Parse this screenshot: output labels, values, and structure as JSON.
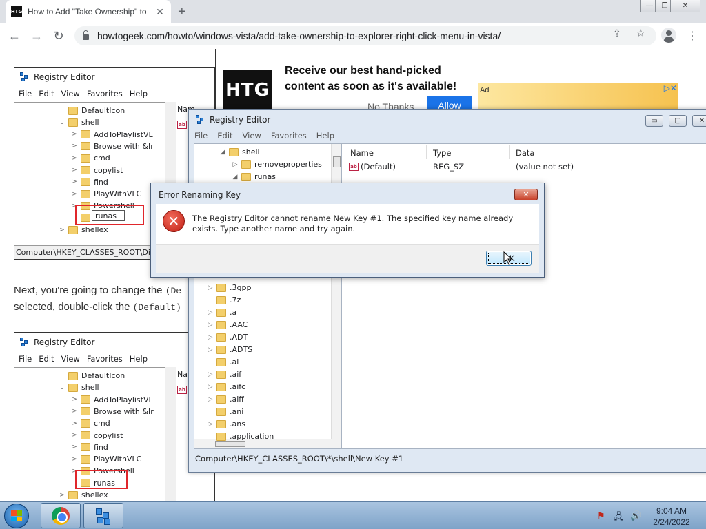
{
  "browser": {
    "tab": {
      "title": "How to Add \"Take Ownership\" to",
      "favicon": "HTG",
      "close": "✕"
    },
    "new_tab": "+",
    "window_controls": {
      "minimize": "—",
      "restore": "❐",
      "close": "✕"
    },
    "nav": {
      "back": "←",
      "forward": "→",
      "reload": "↻"
    },
    "url": "howtogeek.com/howto/windows-vista/add-take-ownership-to-explorer-right-click-menu-in-vista/",
    "omnibox_icons": {
      "share": "⇪",
      "bookmark": "☆"
    },
    "menu": "⋮"
  },
  "page": {
    "ad": {
      "logo": "HTG",
      "headline": "Receive our best hand-picked content as soon as it's available!",
      "no_thanks": "No Thanks",
      "allow": "Allow",
      "banner_tag": "Ad",
      "banner_close": "▷✕"
    },
    "paragraph": {
      "line1_prefix": "Next, you're going to change the ",
      "line1_code": "(De",
      "line2_prefix": "selected, double-click the ",
      "line2_code": "(Default)"
    },
    "screenshot1": {
      "title": "Registry Editor",
      "menu": [
        "File",
        "Edit",
        "View",
        "Favorites",
        "Help"
      ],
      "tree": [
        {
          "label": "DefaultIcon",
          "indent": 1,
          "exp": ""
        },
        {
          "label": "shell",
          "indent": 1,
          "exp": "⌄"
        },
        {
          "label": "AddToPlaylistVL",
          "indent": 2,
          "exp": ">"
        },
        {
          "label": "Browse with &Ir",
          "indent": 2,
          "exp": ">"
        },
        {
          "label": "cmd",
          "indent": 2,
          "exp": ">"
        },
        {
          "label": "copylist",
          "indent": 2,
          "exp": ">"
        },
        {
          "label": "find",
          "indent": 2,
          "exp": ">"
        },
        {
          "label": "PlayWithVLC",
          "indent": 2,
          "exp": ">"
        },
        {
          "label": "Powershell",
          "indent": 2,
          "exp": ">"
        },
        {
          "label": "",
          "indent": 2,
          "exp": ""
        },
        {
          "label": "shellex",
          "indent": 1,
          "exp": ">"
        }
      ],
      "edit_value": "runas",
      "list_header": "Nam",
      "list_value": "(D",
      "status": "Computer\\HKEY_CLASSES_ROOT\\Dire"
    },
    "screenshot2": {
      "title": "Registry Editor",
      "menu": [
        "File",
        "Edit",
        "View",
        "Favorites",
        "Help"
      ],
      "tree": [
        {
          "label": "DefaultIcon",
          "indent": 1,
          "exp": ""
        },
        {
          "label": "shell",
          "indent": 1,
          "exp": "⌄"
        },
        {
          "label": "AddToPlaylistVL",
          "indent": 2,
          "exp": ">"
        },
        {
          "label": "Browse with &Ir",
          "indent": 2,
          "exp": ">"
        },
        {
          "label": "cmd",
          "indent": 2,
          "exp": ">"
        },
        {
          "label": "copylist",
          "indent": 2,
          "exp": ">"
        },
        {
          "label": "find",
          "indent": 2,
          "exp": ">"
        },
        {
          "label": "PlayWithVLC",
          "indent": 2,
          "exp": ">"
        },
        {
          "label": "Powershell",
          "indent": 2,
          "exp": ">"
        },
        {
          "label": "runas",
          "indent": 2,
          "exp": ""
        },
        {
          "label": "shellex",
          "indent": 1,
          "exp": ">"
        }
      ],
      "list_header": "Nam",
      "list_value": "(D"
    }
  },
  "regedit": {
    "title": "Registry Editor",
    "buttons": {
      "minimize": "▭",
      "maximize": "▢",
      "close": "✕"
    },
    "menu": [
      "File",
      "Edit",
      "View",
      "Favorites",
      "Help"
    ],
    "tree_top": [
      {
        "label": "shell",
        "exp": "◢",
        "indent": 0
      },
      {
        "label": "removeproperties",
        "exp": "▷",
        "indent": 1
      },
      {
        "label": "runas",
        "exp": "◢",
        "indent": 1
      }
    ],
    "tree_bottom": [
      ".3gpp",
      ".7z",
      ".a",
      ".AAC",
      ".ADT",
      ".ADTS",
      ".ai",
      ".aif",
      ".aifc",
      ".aiff",
      ".ani",
      ".ans",
      ".application"
    ],
    "tree_bottom_expandable": [
      true,
      false,
      true,
      true,
      true,
      true,
      false,
      true,
      true,
      true,
      false,
      true,
      false
    ],
    "columns": [
      "Name",
      "Type",
      "Data"
    ],
    "value": {
      "name": "(Default)",
      "type": "REG_SZ",
      "data": "(value not set)"
    },
    "status": "Computer\\HKEY_CLASSES_ROOT\\*\\shell\\New Key #1"
  },
  "dialog": {
    "title": "Error Renaming Key",
    "close": "✕",
    "message": "The Registry Editor cannot rename New Key #1. The specified key name already exists. Type another name and try again.",
    "ok": "OK"
  },
  "taskbar": {
    "time": "9:04 AM",
    "date": "2/24/2022",
    "tray": {
      "action_center": "⚑",
      "network": "🖧",
      "volume": "🔊"
    }
  }
}
